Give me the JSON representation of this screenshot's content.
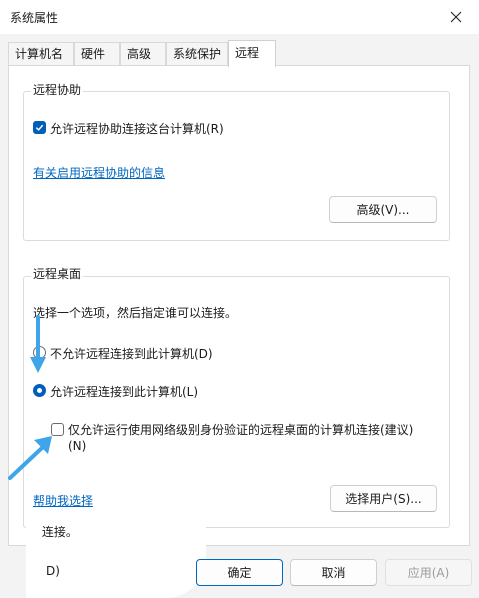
{
  "window": {
    "title": "系统属性",
    "close_icon": "close-icon"
  },
  "tabs": [
    {
      "label": "计算机名"
    },
    {
      "label": "硬件"
    },
    {
      "label": "高级"
    },
    {
      "label": "系统保护"
    },
    {
      "label": "远程",
      "active": true
    }
  ],
  "remote_assistance": {
    "title": "远程协助",
    "allow_checkbox": {
      "label": "允许远程协助连接这台计算机(R)",
      "checked": true
    },
    "info_link": "有关启用远程协助的信息",
    "advanced_button": "高级(V)..."
  },
  "remote_desktop": {
    "title": "远程桌面",
    "instruction": "选择一个选项，然后指定谁可以连接。",
    "option_deny": {
      "label": "不允许远程连接到此计算机(D)",
      "selected": false
    },
    "option_allow": {
      "label": "允许远程连接到此计算机(L)",
      "selected": true
    },
    "nla_checkbox": {
      "label_line1": "仅允许运行使用网络级别身份验证的远程桌面的计算机连接(建议)",
      "label_line2": "(N)",
      "checked": false
    },
    "help_link": "帮助我选择",
    "select_users_button": "选择用户(S)...",
    "partial_text_1": " 连接。",
    "partial_text_2": "D)"
  },
  "footer": {
    "ok": "确定",
    "cancel": "取消",
    "apply": "应用(A)"
  },
  "colors": {
    "accent": "#005fb8",
    "link": "#0067c0",
    "annotation_arrow": "#3fa5e8"
  }
}
